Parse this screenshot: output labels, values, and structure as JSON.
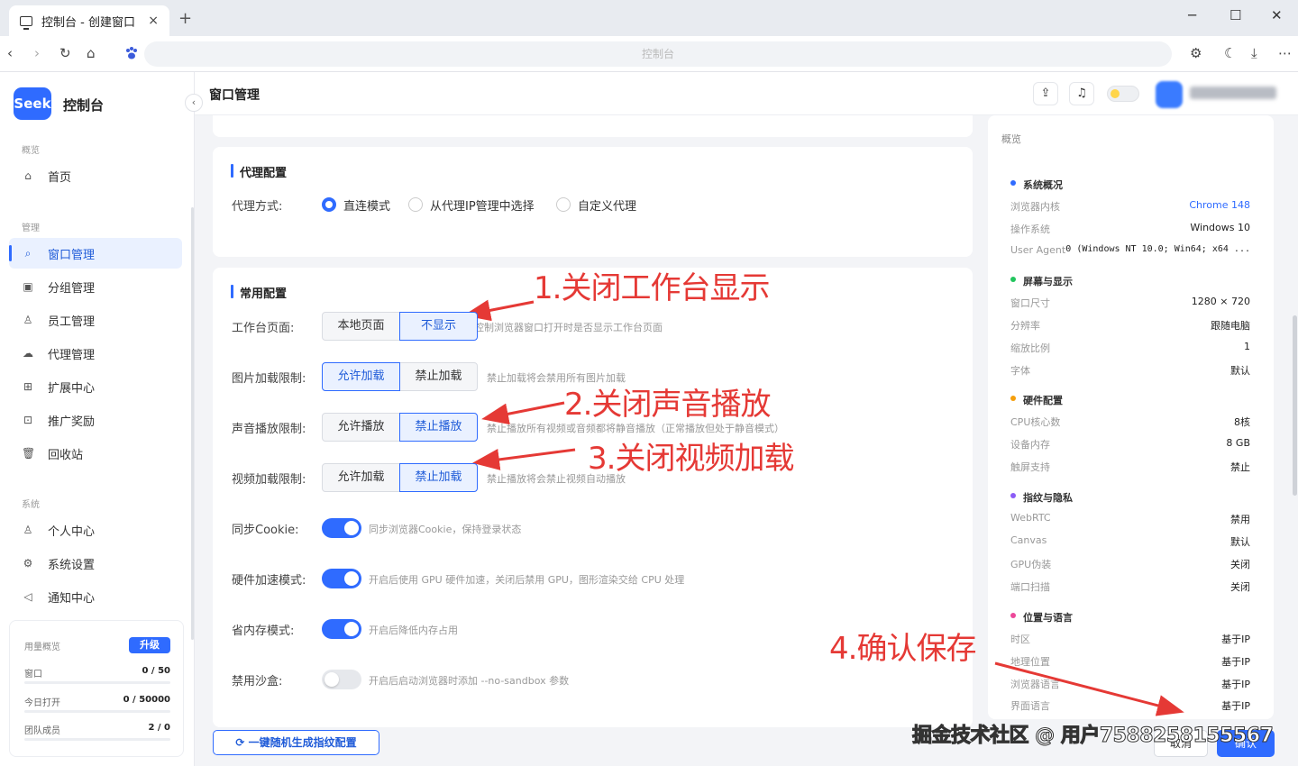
{
  "browser": {
    "tab_title": "控制台 - 创建窗口",
    "new_tab": "+",
    "close_tab": "×",
    "url_text": "控制台",
    "window_controls": [
      "─",
      "☐",
      "✕"
    ]
  },
  "sidebar": {
    "logo": "Seek",
    "brand": "控制台",
    "collapse": "‹",
    "sections": {
      "overview": "概览",
      "manage": "管理",
      "system": "系统"
    },
    "items": [
      {
        "label": "首页",
        "icon": "⌂",
        "icon_name": "home-icon"
      },
      {
        "label": "窗口管理",
        "icon": "⌕",
        "icon_name": "search-window-icon"
      },
      {
        "label": "分组管理",
        "icon": "▣",
        "icon_name": "group-icon"
      },
      {
        "label": "员工管理",
        "icon": "♙",
        "icon_name": "staff-icon"
      },
      {
        "label": "代理管理",
        "icon": "☁",
        "icon_name": "cloud-icon"
      },
      {
        "label": "扩展中心",
        "icon": "⊞",
        "icon_name": "grid-icon"
      },
      {
        "label": "推广奖励",
        "icon": "⊡",
        "icon_name": "gift-icon"
      },
      {
        "label": "回收站",
        "icon": "🗑",
        "icon_name": "trash-icon"
      },
      {
        "label": "个人中心",
        "icon": "♙",
        "icon_name": "user-icon"
      },
      {
        "label": "系统设置",
        "icon": "⚙",
        "icon_name": "gear-icon"
      },
      {
        "label": "通知中心",
        "icon": "◁",
        "icon_name": "notify-icon"
      }
    ],
    "usage": {
      "title": "用量概览",
      "upgrade": "升级",
      "rows": [
        {
          "label": "窗口",
          "used": "0",
          "total": "50"
        },
        {
          "label": "今日打开",
          "used": "0",
          "total": "50000"
        },
        {
          "label": "团队成员",
          "used": "2",
          "total": "0"
        }
      ]
    }
  },
  "header": {
    "title": "窗口管理"
  },
  "proxy": {
    "title": "代理配置",
    "label": "代理方式:",
    "options": [
      "直连模式",
      "从代理IP管理中选择",
      "自定义代理"
    ],
    "selected": "直连模式"
  },
  "common": {
    "title": "常用配置",
    "rows": [
      {
        "label": "工作台页面:",
        "options": [
          "本地页面",
          "不显示"
        ],
        "selected": "不显示",
        "hint": "控制浏览器窗口打开时是否显示工作台页面"
      },
      {
        "label": "图片加载限制:",
        "options": [
          "允许加载",
          "禁止加载"
        ],
        "selected": "允许加载",
        "hint": "禁止加载将会禁用所有图片加载"
      },
      {
        "label": "声音播放限制:",
        "options": [
          "允许播放",
          "禁止播放"
        ],
        "selected": "禁止播放",
        "hint": "禁止播放所有视频或音频都将静音播放（正常播放但处于静音模式）"
      },
      {
        "label": "视频加载限制:",
        "options": [
          "允许加载",
          "禁止加载"
        ],
        "selected": "禁止加载",
        "hint": "禁止播放将会禁止视频自动播放"
      }
    ],
    "toggles": [
      {
        "label": "同步Cookie:",
        "on": true,
        "hint": "同步浏览器Cookie，保持登录状态"
      },
      {
        "label": "硬件加速模式:",
        "on": true,
        "hint": "开启后使用 GPU 硬件加速，关闭后禁用 GPU，图形渲染交给 CPU 处理"
      },
      {
        "label": "省内存模式:",
        "on": true,
        "hint": "开启后降低内存占用"
      },
      {
        "label": "禁用沙盒:",
        "on": false,
        "hint": "开启后启动浏览器时添加 --no-sandbox 参数"
      }
    ]
  },
  "generate_button": "一键随机生成指纹配置",
  "overview": {
    "title": "概览",
    "groups": [
      {
        "name": "系统概况",
        "color": "#2f6bff",
        "rows": [
          [
            "浏览器内核",
            "Chrome 148"
          ],
          [
            "操作系统",
            "Windows 10"
          ],
          [
            "User Agent",
            "0 (Windows NT 10.0; Win64; x64 ..."
          ]
        ]
      },
      {
        "name": "屏幕与显示",
        "color": "#22c55e",
        "rows": [
          [
            "窗口尺寸",
            "1280 × 720"
          ],
          [
            "分辨率",
            "跟随电脑"
          ],
          [
            "缩放比例",
            "1"
          ],
          [
            "字体",
            "默认"
          ]
        ]
      },
      {
        "name": "硬件配置",
        "color": "#f59e0b",
        "rows": [
          [
            "CPU核心数",
            "8核"
          ],
          [
            "设备内存",
            "8 GB"
          ],
          [
            "触屏支持",
            "禁止"
          ]
        ]
      },
      {
        "name": "指纹与隐私",
        "color": "#8b5cf6",
        "rows": [
          [
            "WebRTC",
            "禁用"
          ],
          [
            "Canvas",
            "默认"
          ],
          [
            "GPU伪装",
            "关闭"
          ],
          [
            "端口扫描",
            "关闭"
          ]
        ]
      },
      {
        "name": "位置与语言",
        "color": "#ec4899",
        "rows": [
          [
            "时区",
            "基于IP"
          ],
          [
            "地理位置",
            "基于IP"
          ],
          [
            "浏览器语言",
            "基于IP"
          ],
          [
            "界面语言",
            "基于IP"
          ]
        ]
      }
    ]
  },
  "footer": {
    "cancel": "取消",
    "confirm": "确认"
  },
  "annotations": [
    "1.关闭工作台显示",
    "2.关闭声音播放",
    "3.关闭视频加载",
    "4.确认保存"
  ],
  "watermark": "掘金技术社区 @ 用户7588258155567",
  "colors": {
    "accent": "#2f6bff",
    "annotation": "#e53935"
  }
}
